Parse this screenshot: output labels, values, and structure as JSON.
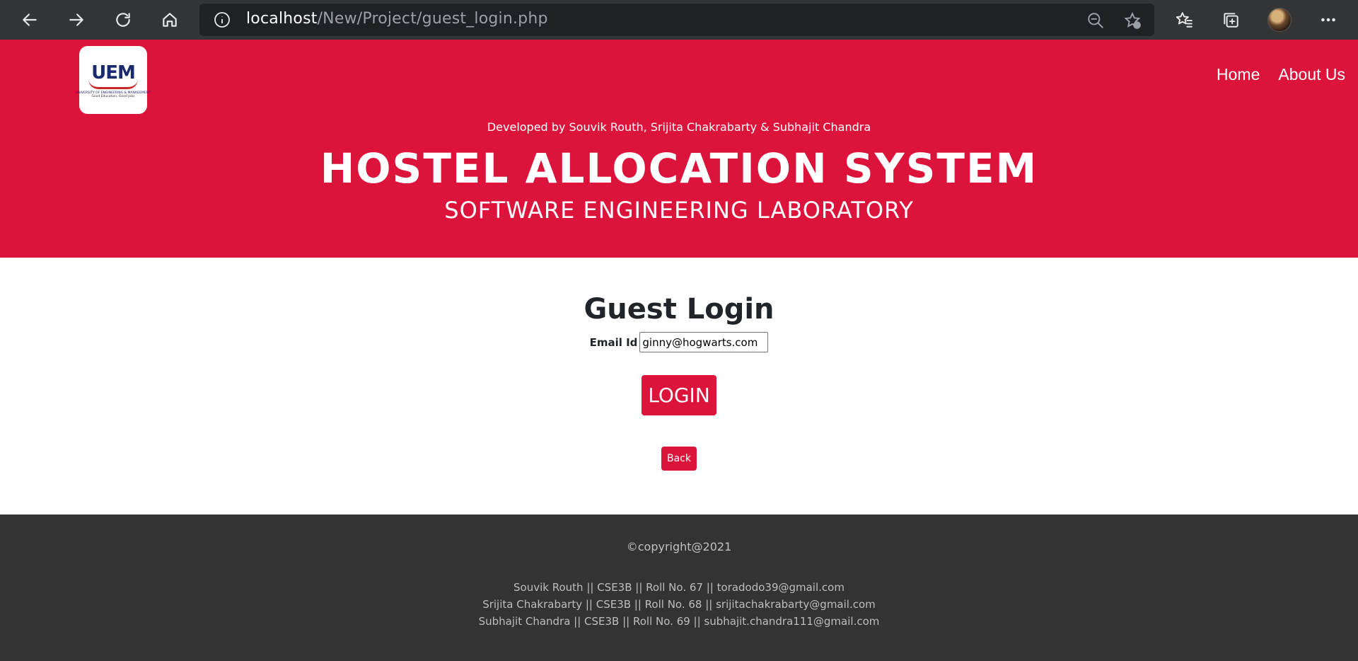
{
  "browser": {
    "url_host": "localhost",
    "url_path": "/New/Project/guest_login.php",
    "icons": [
      "back-arrow-icon",
      "forward-arrow-icon",
      "refresh-icon",
      "home-icon",
      "info-icon",
      "zoom-out-icon",
      "add-favorite-icon",
      "favorites-icon",
      "collections-icon",
      "profile-avatar",
      "more-menu-icon"
    ]
  },
  "header": {
    "logo_text": "UEM",
    "logo_subtext": "UNIVERSITY OF ENGINEERING & MANAGEMENT",
    "logo_tagline": "Good Education, Good Jobs",
    "nav": [
      {
        "label": "Home"
      },
      {
        "label": "About Us"
      }
    ],
    "credits": "Developed by Souvik Routh, Srijita Chakrabarty & Subhajit Chandra",
    "title": "HOSTEL ALLOCATION SYSTEM",
    "subtitle": "SOFTWARE ENGINEERING LABORATORY",
    "bg_color": "#dc143c"
  },
  "main": {
    "heading": "Guest Login",
    "email_label": "Email Id",
    "email_value": "ginny@hogwarts.com",
    "login_label": "LOGIN",
    "back_label": "Back"
  },
  "footer": {
    "copyright": "©copyright@2021",
    "members": [
      "Souvik Routh || CSE3B || Roll No. 67 || toradodo39@gmail.com",
      "Srijita Chakrabarty || CSE3B || Roll No. 68 || srijitachakrabarty@gmail.com",
      "Subhajit Chandra || CSE3B || Roll No. 69 || subhajit.chandra111@gmail.com"
    ],
    "bg_color": "#333333"
  }
}
